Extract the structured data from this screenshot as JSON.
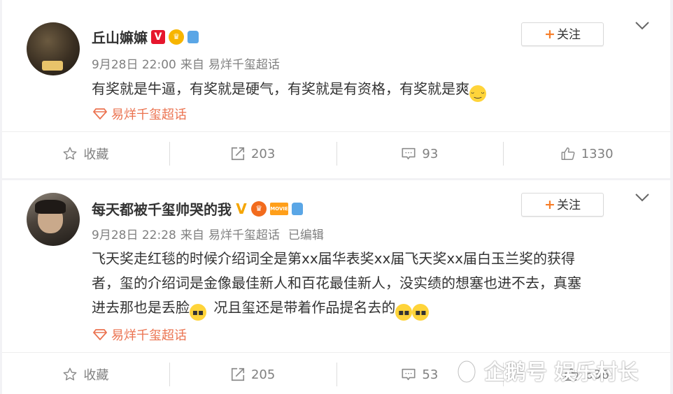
{
  "posts": [
    {
      "username": "丘山嫲嫲",
      "verified_badge": "V",
      "time": "9月28日 22:00",
      "source_prefix": "来自",
      "source": "易烊千玺超话",
      "edited": "",
      "text": "有奖就是牛逼，有奖就是硬气，有奖就是有资格，有奖就是爽",
      "topic": "易烊千玺超话",
      "follow_label": "关注",
      "actions": {
        "favorite": "收藏",
        "repost": "203",
        "comment": "93",
        "like": "1330"
      }
    },
    {
      "username": "每天都被千玺帅哭的我",
      "verified_badge": "V",
      "movie_badge": "MOVIE",
      "time": "9月28日 22:28",
      "source_prefix": "来自",
      "source": "易烊千玺超话",
      "edited": "已编辑",
      "text_lines": [
        "飞天奖走红毯的时候介绍词全是第xx届华表奖xx届飞天奖xx届白玉兰奖的获得",
        "者，玺的介绍词是金像最佳新人和百花最佳新人，没实绩的想塞也进不去，真塞",
        "进去那也是丢脸",
        "况且玺还是带着作品提名去的"
      ],
      "topic": "易烊千玺超话",
      "follow_label": "关注",
      "actions": {
        "favorite": "收藏",
        "repost": "205",
        "comment": "53",
        "like": "636"
      }
    }
  ],
  "watermark": "企鹅号 娱乐村长",
  "colors": {
    "accent_orange": "#eb7350",
    "verified_red": "#e6162d",
    "muted": "#808080"
  },
  "icons": [
    "star-icon",
    "repost-icon",
    "comment-icon",
    "like-icon",
    "chevron-down-icon",
    "topic-diamond-icon"
  ]
}
